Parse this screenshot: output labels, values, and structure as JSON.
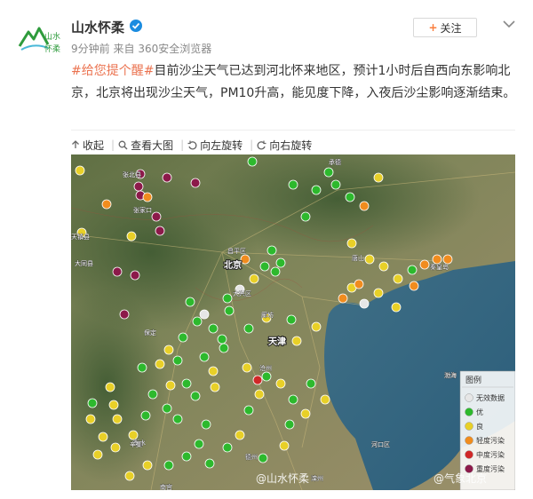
{
  "post": {
    "username": "山水怀柔",
    "time": "9分钟前",
    "source_prefix": "来自",
    "source": "360安全浏览器",
    "follow_label": "关注",
    "hashtag": "#给您提个醒#",
    "text": "目前沙尘天气已达到河北怀来地区，预计1小时后自西向东影响北京，北京将出现沙尘天气，PM10升高，能见度下降，入夜后沙尘影响逐渐结束。"
  },
  "avatar": {
    "logo_text": "山水",
    "logo_subtext": "怀柔"
  },
  "toolbar": {
    "collapse": "收起",
    "view_large": "查看大图",
    "rotate_left": "向左旋转",
    "rotate_right": "向右旋转"
  },
  "map": {
    "city_labels": {
      "beijing": "北京",
      "tianjin": "天津"
    },
    "place_labels": [
      {
        "id": "p1",
        "text": "张北县"
      },
      {
        "id": "p2",
        "text": "张家口"
      },
      {
        "id": "p3",
        "text": "天镇县"
      },
      {
        "id": "p4",
        "text": "大同县"
      },
      {
        "id": "p5",
        "text": "昌平区"
      },
      {
        "id": "p6",
        "text": "大兴区"
      },
      {
        "id": "p7",
        "text": "廊坊"
      },
      {
        "id": "p8",
        "text": "保定"
      },
      {
        "id": "p9",
        "text": "沧州"
      },
      {
        "id": "p10",
        "text": "衡水"
      },
      {
        "id": "p11",
        "text": "德州"
      },
      {
        "id": "p12",
        "text": "秦皇岛"
      },
      {
        "id": "p13",
        "text": "唐山"
      },
      {
        "id": "p14",
        "text": "承德"
      },
      {
        "id": "p15",
        "text": "南宫"
      },
      {
        "id": "p16",
        "text": "渤海"
      },
      {
        "id": "p17",
        "text": "河口区"
      },
      {
        "id": "p18",
        "text": "辛集"
      },
      {
        "id": "p19",
        "text": "滦州"
      }
    ],
    "legend": {
      "title": "图例",
      "items": [
        {
          "label": "无效数据",
          "color": "#e6e6e6"
        },
        {
          "label": "优",
          "color": "#2db92d"
        },
        {
          "label": "良",
          "color": "#e8d028"
        },
        {
          "label": "轻度污染",
          "color": "#f08c1e"
        },
        {
          "label": "中度污染",
          "color": "#d02828"
        },
        {
          "label": "重度污染",
          "color": "#8c1a4a"
        }
      ]
    },
    "watermarks": [
      "@山水怀柔",
      "@气象北京"
    ],
    "colors": {
      "good": "#2db92d",
      "moderate": "#e8d028",
      "light": "#f08c1e",
      "medium": "#d02828",
      "heavy": "#8c1a4a",
      "invalid": "#e6e6e6"
    }
  }
}
